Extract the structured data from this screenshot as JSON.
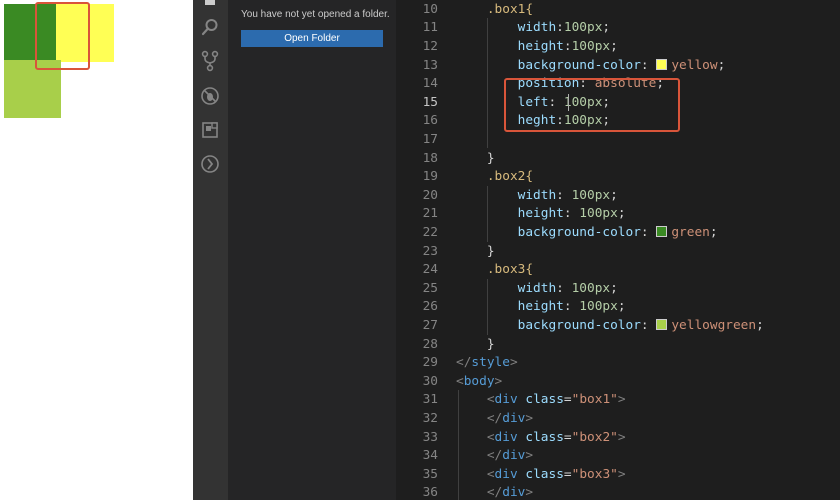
{
  "preview": {
    "colors": {
      "box1": "#ffff55",
      "box2": "#3a8a23",
      "box3": "#a8cf4a"
    }
  },
  "activity_bar": {
    "icons": [
      "search-icon",
      "source-control-icon",
      "debug-icon",
      "extensions-icon",
      "remote-icon"
    ]
  },
  "sidebar": {
    "message": "You have not yet opened a folder.",
    "open_folder_label": "Open Folder"
  },
  "editor": {
    "lines": [
      {
        "n": "10",
        "s": ".box1{"
      },
      {
        "n": "11",
        "p": "width",
        "sep": ":",
        "num": "100px",
        "end": ";"
      },
      {
        "n": "12",
        "p": "height",
        "sep": ":",
        "num": "100px",
        "end": ";"
      },
      {
        "n": "13",
        "p": "background-color",
        "sep": ": ",
        "v": "yellow",
        "end": ";"
      },
      {
        "n": "14",
        "p": "position",
        "sep": ": ",
        "v": "absolute",
        "end": ";"
      },
      {
        "n": "15",
        "p": "left",
        "sep": ": ",
        "num": "100px",
        "end": ";"
      },
      {
        "n": "16",
        "p": "heght",
        "sep": ":",
        "num": "100px",
        "end": ";"
      },
      {
        "n": "17"
      },
      {
        "n": "18",
        "b": "}"
      },
      {
        "n": "19",
        "s": ".box2{"
      },
      {
        "n": "20",
        "p": "width",
        "sep": ": ",
        "num": "100px",
        "end": ";"
      },
      {
        "n": "21",
        "p": "height",
        "sep": ": ",
        "num": "100px",
        "end": ";"
      },
      {
        "n": "22",
        "p": "background-color",
        "sep": ": ",
        "v": "green",
        "end": ";"
      },
      {
        "n": "23",
        "b": "}"
      },
      {
        "n": "24",
        "s": ".box3{"
      },
      {
        "n": "25",
        "p": "width",
        "sep": ": ",
        "num": "100px",
        "end": ";"
      },
      {
        "n": "26",
        "p": "height",
        "sep": ": ",
        "num": "100px",
        "end": ";"
      },
      {
        "n": "27",
        "p": "background-color",
        "sep": ": ",
        "v": "yellowgreen",
        "end": ";"
      },
      {
        "n": "28",
        "b": "}"
      },
      {
        "n": "29",
        "close": "style"
      },
      {
        "n": "30",
        "open": "body"
      },
      {
        "n": "31",
        "open": "div",
        "cls": "box1"
      },
      {
        "n": "32",
        "close": "div"
      },
      {
        "n": "33",
        "open": "div",
        "cls": "box2"
      },
      {
        "n": "34",
        "close": "div"
      },
      {
        "n": "35",
        "open": "div",
        "cls": "box3"
      },
      {
        "n": "36",
        "close": "div"
      }
    ],
    "swatches": {
      "yellow": "#ffff55",
      "green": "#3a8a23",
      "yellowgreen": "#a8cf4a"
    }
  }
}
